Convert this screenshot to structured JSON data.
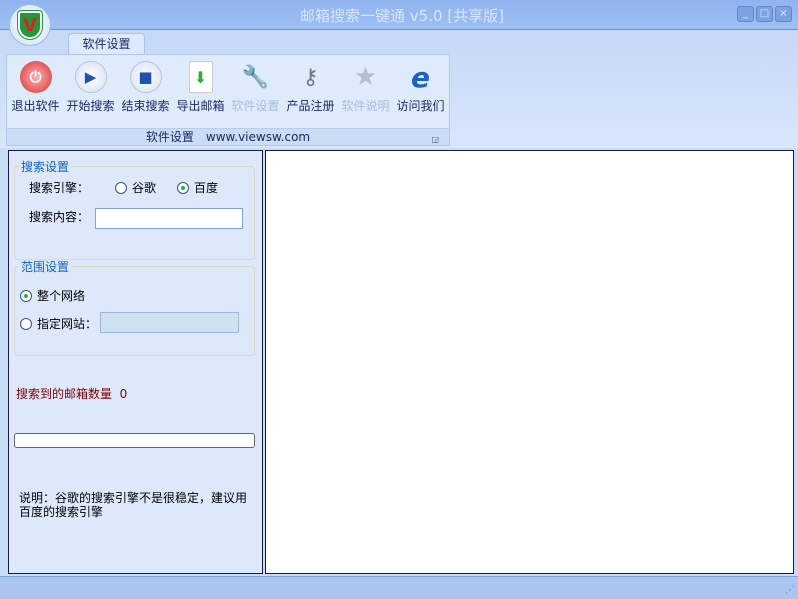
{
  "window": {
    "title": "邮箱搜索一键通 v5.0 [共享版]",
    "logo_letter": "V",
    "controls": [
      "minimize",
      "maximize",
      "close"
    ]
  },
  "ribbon": {
    "tab": "软件设置",
    "tools": [
      {
        "label": "退出软件",
        "icon": "power-icon",
        "enabled": true
      },
      {
        "label": "开始搜索",
        "icon": "play-icon",
        "enabled": true
      },
      {
        "label": "结束搜索",
        "icon": "stop-icon",
        "enabled": true
      },
      {
        "label": "导出邮箱",
        "icon": "export-file-icon",
        "enabled": true
      },
      {
        "label": "软件设置",
        "icon": "tools-icon",
        "enabled": false
      },
      {
        "label": "产品注册",
        "icon": "keys-icon",
        "enabled": true
      },
      {
        "label": "软件说明",
        "icon": "star-icon",
        "enabled": false
      },
      {
        "label": "访问我们",
        "icon": "ie-icon",
        "enabled": true
      }
    ],
    "group_label": "软件设置",
    "group_url": "www.viewsw.com"
  },
  "search_settings": {
    "legend": "搜索设置",
    "engine_label": "搜索引擎：",
    "engines": [
      {
        "label": "谷歌",
        "selected": false
      },
      {
        "label": "百度",
        "selected": true
      }
    ],
    "content_label": "搜索内容：",
    "content_value": ""
  },
  "scope_settings": {
    "legend": "范围设置",
    "options": [
      {
        "label": "整个网络",
        "selected": true
      },
      {
        "label": "指定网站：",
        "selected": false
      }
    ],
    "site_value": ""
  },
  "result": {
    "label": "搜索到的邮箱数量",
    "count": "0",
    "progress": 0
  },
  "note": "说明：谷歌的搜索引擎不是很稳定，建议用百度的搜索引擎"
}
